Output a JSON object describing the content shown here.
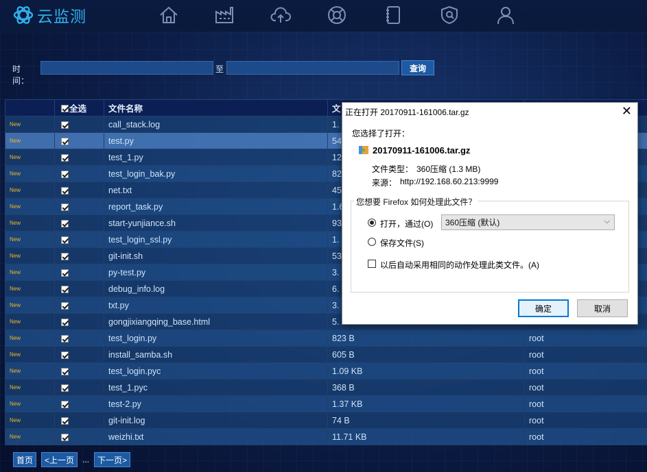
{
  "app": {
    "logo_text": "云监测"
  },
  "nav_icons": [
    "home-icon",
    "factory-icon",
    "cloud-upload-icon",
    "lifebuoy-icon",
    "notebook-icon",
    "shield-icon",
    "user-icon"
  ],
  "filter": {
    "time_label": "时间：",
    "start_value": "",
    "to_label": "至",
    "end_value": "",
    "query_label": "查询"
  },
  "table": {
    "headers": {
      "new": "",
      "select_all": "全选",
      "file_name": "文件名称",
      "size": "文",
      "owner": ""
    },
    "new_label": "New",
    "rows": [
      {
        "name": "call_stack.log",
        "size": "1.",
        "owner": ""
      },
      {
        "name": "test.py",
        "size": "54",
        "owner": ""
      },
      {
        "name": "test_1.py",
        "size": "12",
        "owner": ""
      },
      {
        "name": "test_login_bak.py",
        "size": "82",
        "owner": ""
      },
      {
        "name": "net.txt",
        "size": "45",
        "owner": ""
      },
      {
        "name": "report_task.py",
        "size": "1.6",
        "owner": ""
      },
      {
        "name": "start-yunjiance.sh",
        "size": "93",
        "owner": ""
      },
      {
        "name": "test_login_ssl.py",
        "size": "1.",
        "owner": ""
      },
      {
        "name": "git-init.sh",
        "size": "53",
        "owner": ""
      },
      {
        "name": "py-test.py",
        "size": "3.",
        "owner": ""
      },
      {
        "name": "debug_info.log",
        "size": "6.",
        "owner": ""
      },
      {
        "name": "txt.py",
        "size": "3.",
        "owner": ""
      },
      {
        "name": "gongjixiangqing_base.html",
        "size": "5.",
        "owner": ""
      },
      {
        "name": "test_login.py",
        "size": "823 B",
        "owner": "root"
      },
      {
        "name": "install_samba.sh",
        "size": "605 B",
        "owner": "root"
      },
      {
        "name": "test_login.pyc",
        "size": "1.09 KB",
        "owner": "root"
      },
      {
        "name": "test_1.pyc",
        "size": "368 B",
        "owner": "root"
      },
      {
        "name": "test-2.py",
        "size": "1.37 KB",
        "owner": "root"
      },
      {
        "name": "git-init.log",
        "size": "74 B",
        "owner": "root"
      },
      {
        "name": "weizhi.txt",
        "size": "11.71 KB",
        "owner": "root"
      }
    ]
  },
  "pager": {
    "first": "首页",
    "prev": "<上一页",
    "dots": "...",
    "next": "下一页>"
  },
  "dialog": {
    "title": "正在打开 20170911-161006.tar.gz",
    "chose_label": "您选择了打开：",
    "file_name": "20170911-161006.tar.gz",
    "type_label": "文件类型：",
    "type_value": "360压缩 (1.3 MB)",
    "source_label": "来源：",
    "source_value": "http://192.168.60.213:9999",
    "question": "您想要 Firefox 如何处理此文件？",
    "open_with_label": "打开，通过(O)",
    "open_with_value": "360压缩 (默认)",
    "save_label": "保存文件(S)",
    "auto_label": "以后自动采用相同的动作处理此类文件。(A)",
    "ok_label": "确定",
    "cancel_label": "取消"
  }
}
